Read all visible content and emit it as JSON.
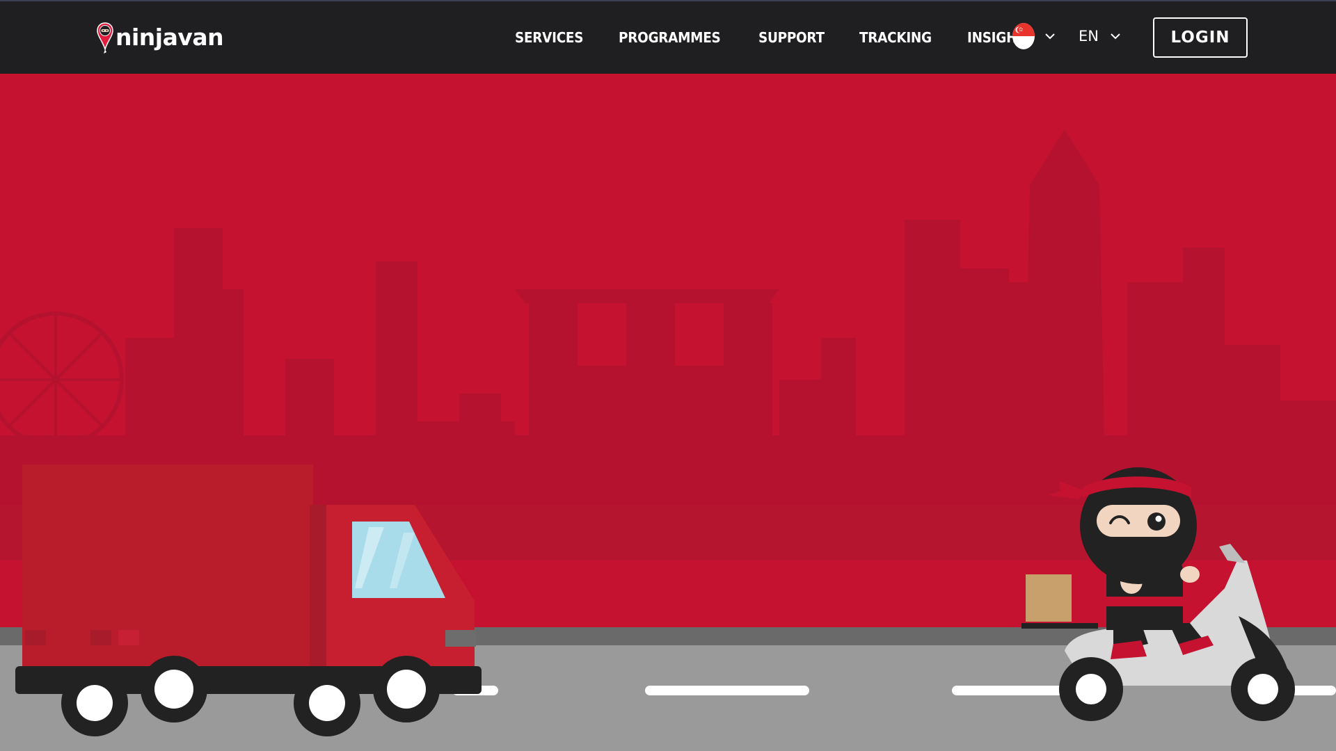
{
  "brand": {
    "name": "ninjavan",
    "logo_icon": "ninja-pin-icon",
    "colors": {
      "primary_red": "#c41230",
      "navbar": "#1f1f21",
      "road": "#9a9a9a"
    }
  },
  "nav": {
    "items": [
      {
        "label": "SERVICES"
      },
      {
        "label": "PROGRAMMES"
      },
      {
        "label": "SUPPORT"
      },
      {
        "label": "TRACKING"
      },
      {
        "label": "INSIGHTS"
      }
    ],
    "country": {
      "icon": "singapore-flag-icon"
    },
    "language": {
      "label": "EN"
    },
    "login_label": "LOGIN"
  }
}
